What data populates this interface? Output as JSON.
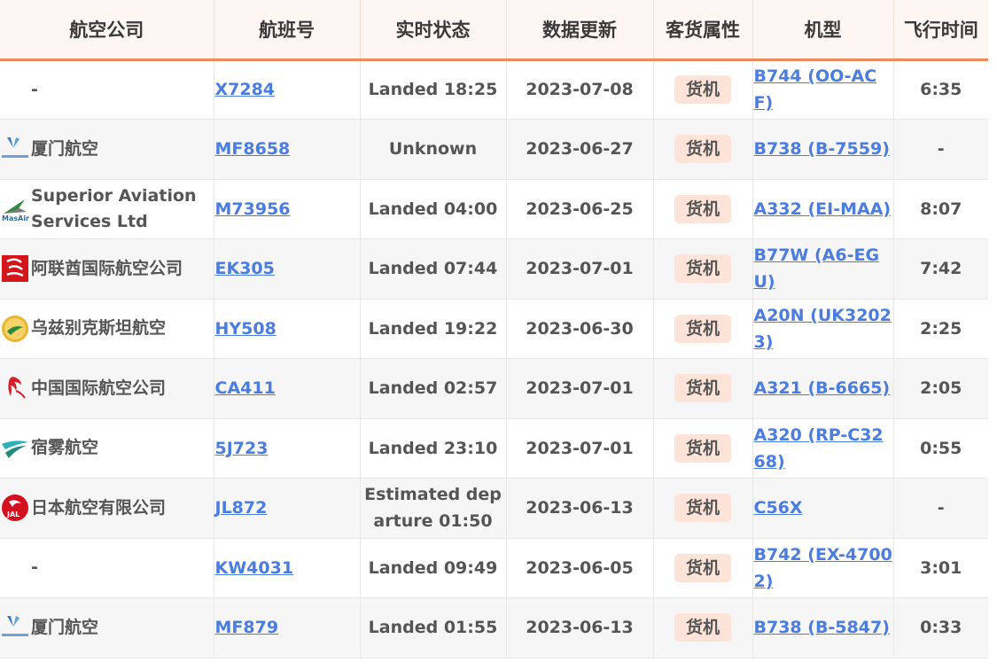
{
  "headers": {
    "airline": "航空公司",
    "flight_no": "航班号",
    "status": "实时状态",
    "updated": "数据更新",
    "type": "客货属性",
    "aircraft": "机型",
    "duration": "飞行时间"
  },
  "colors": {
    "accent": "#ec8a5c",
    "badge_bg": "#fde3d8",
    "link": "#4a7ddf"
  },
  "rows": [
    {
      "airline": "-",
      "logo": "none",
      "flight": "X7284",
      "status": "Landed 18:25",
      "updated": "2023-07-08",
      "type": "货机",
      "aircraft": "B744 (OO-ACF)",
      "duration": "6:35"
    },
    {
      "airline": "厦门航空",
      "logo": "xiamen-airlines-logo",
      "flight": "MF8658",
      "status": "Unknown",
      "updated": "2023-06-27",
      "type": "货机",
      "aircraft": "B738 (B-7559)",
      "duration": "-"
    },
    {
      "airline": "Superior Aviation Services Ltd",
      "logo": "superior-aviation-logo",
      "flight": "M73956",
      "status": "Landed 04:00",
      "updated": "2023-06-25",
      "type": "货机",
      "aircraft": "A332 (EI-MAA)",
      "duration": "8:07"
    },
    {
      "airline": "阿联酋国际航空公司",
      "logo": "emirates-logo",
      "flight": "EK305",
      "status": "Landed 07:44",
      "updated": "2023-07-01",
      "type": "货机",
      "aircraft": "B77W (A6-EGU)",
      "duration": "7:42"
    },
    {
      "airline": "乌兹别克斯坦航空",
      "logo": "uzbekistan-airways-logo",
      "flight": "HY508",
      "status": "Landed 19:22",
      "updated": "2023-06-30",
      "type": "货机",
      "aircraft": "A20N (UK32023)",
      "duration": "2:25"
    },
    {
      "airline": "中国国际航空公司",
      "logo": "air-china-logo",
      "flight": "CA411",
      "status": "Landed 02:57",
      "updated": "2023-07-01",
      "type": "货机",
      "aircraft": "A321 (B-6665)",
      "duration": "2:05"
    },
    {
      "airline": "宿雾航空",
      "logo": "cebu-pacific-logo",
      "flight": "5J723",
      "status": "Landed 23:10",
      "updated": "2023-07-01",
      "type": "货机",
      "aircraft": "A320 (RP-C3268)",
      "duration": "0:55"
    },
    {
      "airline": "日本航空有限公司",
      "logo": "jal-logo",
      "flight": "JL872",
      "status": "Estimated departure 01:50",
      "updated": "2023-06-13",
      "type": "货机",
      "aircraft": "C56X",
      "duration": "-"
    },
    {
      "airline": "-",
      "logo": "none",
      "flight": "KW4031",
      "status": "Landed 09:49",
      "updated": "2023-06-05",
      "type": "货机",
      "aircraft": "B742 (EX-47002)",
      "duration": "3:01"
    },
    {
      "airline": "厦门航空",
      "logo": "xiamen-airlines-logo",
      "flight": "MF879",
      "status": "Landed 01:55",
      "updated": "2023-06-13",
      "type": "货机",
      "aircraft": "B738 (B-5847)",
      "duration": "0:33"
    }
  ]
}
